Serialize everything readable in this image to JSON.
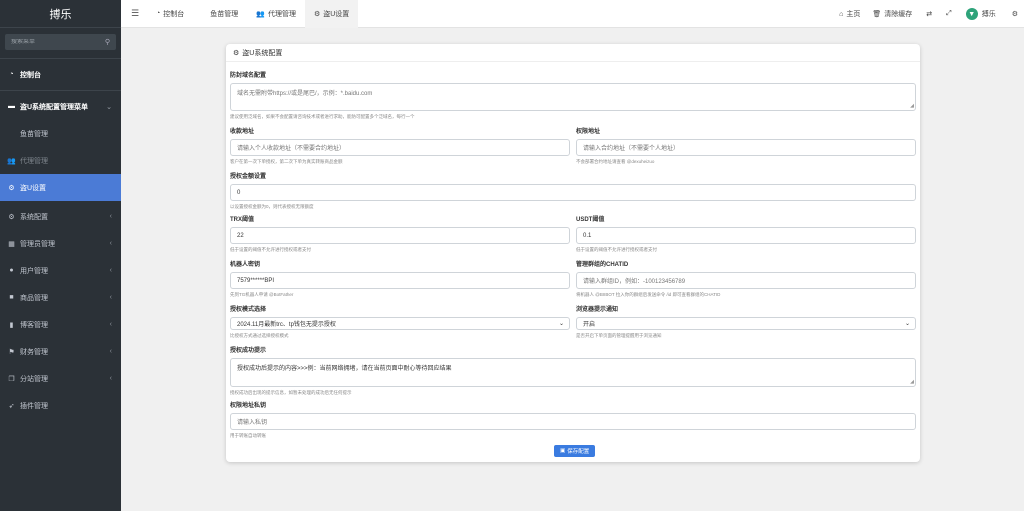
{
  "brand": "搏乐",
  "search": {
    "placeholder": "搜索菜单"
  },
  "sidebar": {
    "items": [
      {
        "label": "控制台",
        "icon": "dashboard-icon"
      },
      {
        "label": "盗U系统配置管理菜单",
        "icon": "monitor-icon"
      },
      {
        "label": "鱼苗管理"
      },
      {
        "label": "代理管理",
        "icon": "users-icon"
      },
      {
        "label": "盗U设置",
        "icon": "gear-icon"
      },
      {
        "label": "系统配置",
        "icon": "gears-icon"
      },
      {
        "label": "管理员管理",
        "icon": "grid-icon"
      },
      {
        "label": "用户管理",
        "icon": "user-icon"
      },
      {
        "label": "商品管理",
        "icon": "box-icon"
      },
      {
        "label": "博客管理",
        "icon": "book-icon"
      },
      {
        "label": "财务管理",
        "icon": "flag-icon"
      },
      {
        "label": "分站管理",
        "icon": "clone-icon"
      },
      {
        "label": "插件管理",
        "icon": "rocket-icon"
      }
    ]
  },
  "header": {
    "tabs": [
      {
        "label": "控制台"
      },
      {
        "label": "鱼苗管理"
      },
      {
        "label": "代理管理"
      },
      {
        "label": "盗U设置"
      }
    ],
    "home": "主页",
    "clear_cache": "清除缓存",
    "user": "搏乐"
  },
  "form": {
    "title": "盗U系统配置",
    "domain": {
      "label": "防封域名配置",
      "placeholder": "域名无需附带https://或是尾巴/，示例：*.baidu.com",
      "help": "建议使用泛域名，如果不会配置请咨询技术或者进行求助，能防可配置多个泛域名，每行一个"
    },
    "pay_addr": {
      "label": "收款地址",
      "placeholder": "请输入个人收款地址（不需要合约地址）",
      "help": "客户在第一次下单授权，第二次下单为真实转账商品金额"
    },
    "auth_addr": {
      "label": "权限地址",
      "placeholder": "请输入合约地址（不需要个人地址）",
      "help": "不会部署合约地址请查看 @dexuheizuo"
    },
    "auth_amount": {
      "label": "授权金额设置",
      "value": "0",
      "help": "以设置授权金额为0，则代表授权无限额度"
    },
    "trx": {
      "label": "TRX阈值",
      "value": "22",
      "help": "低于设置的阈值不允许进行授权或者支付"
    },
    "usdt": {
      "label": "USDT阈值",
      "value": "0.1",
      "help": "低于设置的阈值不允许进行授权或者支付"
    },
    "bot_key": {
      "label": "机器人密钥",
      "value": "7579******BPI",
      "help": "先到TG机器人申请 @BotFather"
    },
    "chat_id": {
      "label": "管理群组的CHATID",
      "placeholder": "请输入群组ID，例如：-100123456789",
      "help": "将机器人 @BIIBOT 拉入你的群组后发送命令 /id 即可查看群组的CHATID"
    },
    "auth_mode": {
      "label": "授权模式选择",
      "value": "2024.11月最新trc、tp钱包无提示授权",
      "help": "比授权方式通过选择授权模式"
    },
    "browser_notify": {
      "label": "浏览器提示通知",
      "value": "开启",
      "help": "是否开启下单页面的管理提醒用于浏览通知"
    },
    "success_tip": {
      "label": "授权成功提示",
      "value": "授权成功后提示的内容>>>例：当前网络拥堵，请在当前页面中耐心等待回应结果",
      "help": "授权成功后出现的提示信息，如暂未处理的成功后无任何提示"
    },
    "private_key": {
      "label": "权限地址私钥",
      "placeholder": "请输入私钥",
      "help": "用于转账自动转账"
    },
    "save_label": "保存配置"
  },
  "colors": {
    "sidebar": "#2b3137",
    "active": "#4b7bd6",
    "save": "#3a7be0",
    "tron": "#2ea37a"
  }
}
